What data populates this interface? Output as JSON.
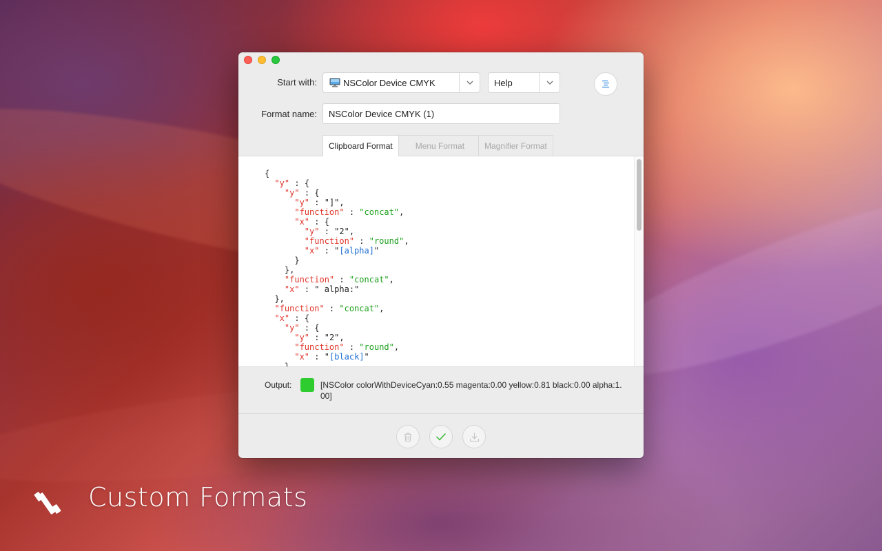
{
  "window": {
    "start_with_label": "Start with:",
    "start_with_value": "NSColor Device CMYK",
    "help_value": "Help",
    "format_name_label": "Format name:",
    "format_name_value": "NSColor Device CMYK (1)",
    "tabs": [
      {
        "label": "Clipboard Format",
        "active": true
      },
      {
        "label": "Menu Format",
        "active": false
      },
      {
        "label": "Magnifier Format",
        "active": false
      }
    ],
    "code_lines": [
      "{",
      "  \"y\" : {",
      "    \"y\" : {",
      "      \"y\" : \"]\",",
      "      \"function\" : \"concat\",",
      "      \"x\" : {",
      "        \"y\" : \"2\",",
      "        \"function\" : \"round\",",
      "        \"x\" : \"[alpha]\"",
      "      }",
      "    },",
      "    \"function\" : \"concat\",",
      "    \"x\" : \" alpha:\"",
      "  },",
      "  \"function\" : \"concat\",",
      "  \"x\" : {",
      "    \"y\" : {",
      "      \"y\" : \"2\",",
      "      \"function\" : \"round\",",
      "      \"x\" : \"[black]\"",
      "    },"
    ],
    "output_label": "Output:",
    "output_color": "#2ecc2e",
    "output_text": "[NSColor colorWithDeviceCyan:0.55 magenta:0.00 yellow:0.81 black:0.00 alpha:1.00]",
    "footer_icons": [
      "trash-icon",
      "checkmark-icon",
      "download-icon"
    ]
  },
  "caption": "Custom Formats",
  "colors": {
    "key": "#e0362c",
    "string": "#1ea11e",
    "variable": "#1e6fd4",
    "check": "#3bb83b"
  }
}
